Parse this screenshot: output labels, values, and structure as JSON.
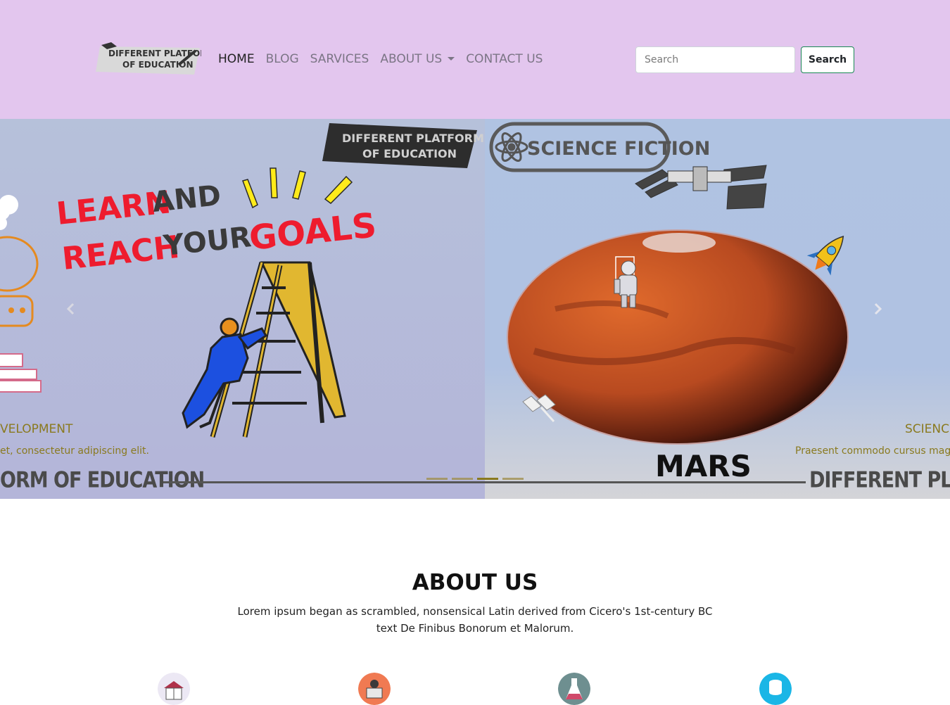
{
  "navbar": {
    "logo_lines": [
      "DIFFERENT PLATFORM",
      "OF EDUCATION"
    ],
    "links": [
      {
        "label": "HOME",
        "active": true
      },
      {
        "label": "BLOG",
        "active": false
      },
      {
        "label": "SARVICES",
        "active": false
      },
      {
        "label": "ABOUT US",
        "active": false,
        "dropdown": true
      },
      {
        "label": "CONTACT US",
        "active": false
      }
    ],
    "search_placeholder": "Search",
    "search_button": "Search",
    "background": "#e3c6ee"
  },
  "carousel": {
    "left_slide": {
      "logo_lines": [
        "DIFFERENT PLATFORM",
        "OF EDUCATION"
      ],
      "headline_words": [
        "LEARN",
        "AND",
        "REACH",
        "YOUR",
        "GOALS"
      ],
      "caption_title": "VELOPMENT",
      "caption_text": "et, consectetur adipiscing elit.",
      "band_text": "ORM OF EDUCATION"
    },
    "right_slide": {
      "badge_text": "SCIENCE FICTION",
      "planet_label": "MARS",
      "caption_title": "SCIENC",
      "caption_text": "Praesent commodo cursus mag",
      "band_text": "DIFFERENT PLATFO"
    },
    "indicator_count": 4,
    "active_indicator": 2,
    "prev_icon": "chevron-left-icon",
    "next_icon": "chevron-right-icon",
    "caption_color": "#8a7a1f"
  },
  "about": {
    "title": "ABOUT US",
    "text": "Lorem ipsum began as scrambled, nonsensical Latin derived from Cicero's 1st-century BC text De Finibus Bonorum et Malorum."
  },
  "features": [
    {
      "icon": "book-icon",
      "color": "#e8e4f0"
    },
    {
      "icon": "laptop-gear-icon",
      "color": "#f07a52"
    },
    {
      "icon": "flask-icon",
      "color": "#6e8f90"
    },
    {
      "icon": "database-icon",
      "color": "#1ab6e6"
    }
  ]
}
